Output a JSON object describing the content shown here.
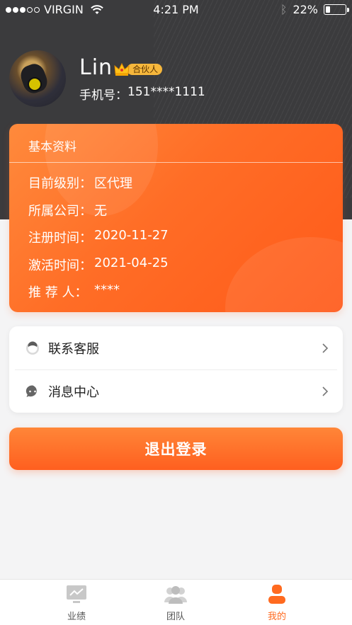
{
  "status_bar": {
    "carrier": "VIRGIN",
    "time": "4:21 PM",
    "battery_percent": "22%",
    "battery_level": 0.22
  },
  "profile": {
    "name": "Lin",
    "badge": "合伙人",
    "phone_label": "手机号：",
    "phone_value": "151****1111"
  },
  "info_card": {
    "title": "基本资料",
    "rows": [
      {
        "label": "目前级别：",
        "value": "区代理"
      },
      {
        "label": "所属公司：",
        "value": "无"
      },
      {
        "label": "注册时间：",
        "value": "2020-11-27"
      },
      {
        "label": "激活时间：",
        "value": "2021-04-25"
      },
      {
        "label": "推 荐 人：",
        "value": "****"
      }
    ]
  },
  "menu": {
    "items": [
      {
        "label": "联系客服",
        "icon": "customer-service-icon"
      },
      {
        "label": "消息中心",
        "icon": "message-icon"
      }
    ]
  },
  "logout_label": "退出登录",
  "tabbar": {
    "tabs": [
      {
        "label": "业绩",
        "icon": "monitor-chart-icon",
        "active": false
      },
      {
        "label": "团队",
        "icon": "team-icon",
        "active": false
      },
      {
        "label": "我的",
        "icon": "user-icon",
        "active": true
      }
    ]
  },
  "colors": {
    "accent": "#ff6a1f",
    "header_bg": "#3b3b3d",
    "badge": "#f6b73c"
  }
}
